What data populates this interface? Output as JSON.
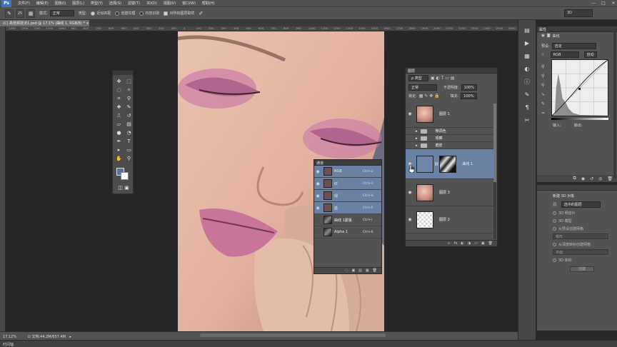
{
  "app": {
    "logo": "Ps"
  },
  "menu": [
    "文件(F)",
    "编辑(E)",
    "图像(I)",
    "图层(L)",
    "类型(Y)",
    "选择(S)",
    "滤镜(T)",
    "3D(D)",
    "视图(V)",
    "窗口(W)",
    "帮助(H)"
  ],
  "window_controls": [
    "—",
    "□",
    "✕"
  ],
  "options": {
    "brush_size": "25",
    "mode_label": "模式:",
    "mode_value": "正常",
    "type_label": "类型:",
    "opt1": "近似匹配",
    "opt2": "创建纹理",
    "opt3": "内容识别",
    "opt4": "对所有图层取样",
    "workspace": "3D"
  },
  "document": {
    "tab_title": "(C) 高低频技法1.psd @ 17.1% (曲线 1, RGB/8) *",
    "close": "×"
  },
  "ruler_ticks": [
    "1400",
    "1300",
    "1200",
    "1100",
    "1000",
    "900",
    "800",
    "700",
    "600",
    "500",
    "400",
    "300",
    "200",
    "100",
    "0",
    "100",
    "200",
    "300",
    "400",
    "500",
    "600",
    "700",
    "800",
    "900",
    "1000",
    "1100",
    "1200",
    "1300",
    "1400",
    "1500",
    "1600",
    "1700",
    "1800",
    "1900",
    "2000",
    "2100",
    "2200",
    "2300",
    "2400",
    "2500",
    "2600"
  ],
  "status": {
    "zoom": "17.12%",
    "doc_info": "文档:44.2M/657.4M",
    "arrow": "▸"
  },
  "timeline_label": "时间轴",
  "channels": {
    "title": "通道",
    "rows": [
      {
        "name": "RGB",
        "key": "Ctrl+2",
        "selected": true
      },
      {
        "name": "红",
        "key": "Ctrl+3",
        "selected": true
      },
      {
        "name": "绿",
        "key": "Ctrl+4",
        "selected": true
      },
      {
        "name": "蓝",
        "key": "Ctrl+5",
        "selected": true
      },
      {
        "name": "曲线 1蒙版",
        "key": "Ctrl+\\",
        "selected": false
      },
      {
        "name": "Alpha 1",
        "key": "Ctrl+6",
        "selected": false
      }
    ],
    "footer_icons": [
      "◌",
      "▣",
      "▤",
      "▦",
      "🗑"
    ]
  },
  "layers": {
    "title": "图层",
    "kind_label": "ρ 类型",
    "blend_mode": "正常",
    "opacity_label": "不透明度:",
    "opacity_value": "100%",
    "lock_label": "锁定:",
    "fill_label": "填充:",
    "fill_value": "100%",
    "rows": [
      {
        "name": "图层 1",
        "type": "face",
        "selected": false
      },
      {
        "name": "微调色",
        "type": "folder",
        "selected": false
      },
      {
        "name": "观察",
        "type": "folder",
        "selected": false
      },
      {
        "name": "磨皮",
        "type": "folder",
        "selected": false
      },
      {
        "name": "曲线 1",
        "type": "curves",
        "selected": true
      },
      {
        "name": "图层 3",
        "type": "face",
        "selected": false
      },
      {
        "name": "图层 2",
        "type": "checker",
        "selected": false
      }
    ],
    "footer_icons": [
      "∞",
      "fx",
      "◐",
      "◑",
      "▭",
      "▣",
      "🗑"
    ]
  },
  "properties": {
    "tab": "属性",
    "title": "曲线",
    "preset_label": "预设:",
    "preset_value": "自定",
    "channel_value": "RGB",
    "auto_label": "自动",
    "input_label": "输入:",
    "output_label": "输出:"
  },
  "panel3d": {
    "title": "新建 3D 对象",
    "source_label": "源:",
    "source_value": "选中的图层",
    "opt1": "3D 明信片",
    "opt2": "3D 模型",
    "opt3": "从预设创建网格",
    "opt3_select": "帽形",
    "opt4": "从深度映射创建网格",
    "opt4_select": "平面",
    "opt5": "3D 体积",
    "create_btn": "创建"
  },
  "colors": {
    "accent_selection": "#6881a5",
    "foreground": "#5d7197",
    "background": "#ffffff"
  }
}
